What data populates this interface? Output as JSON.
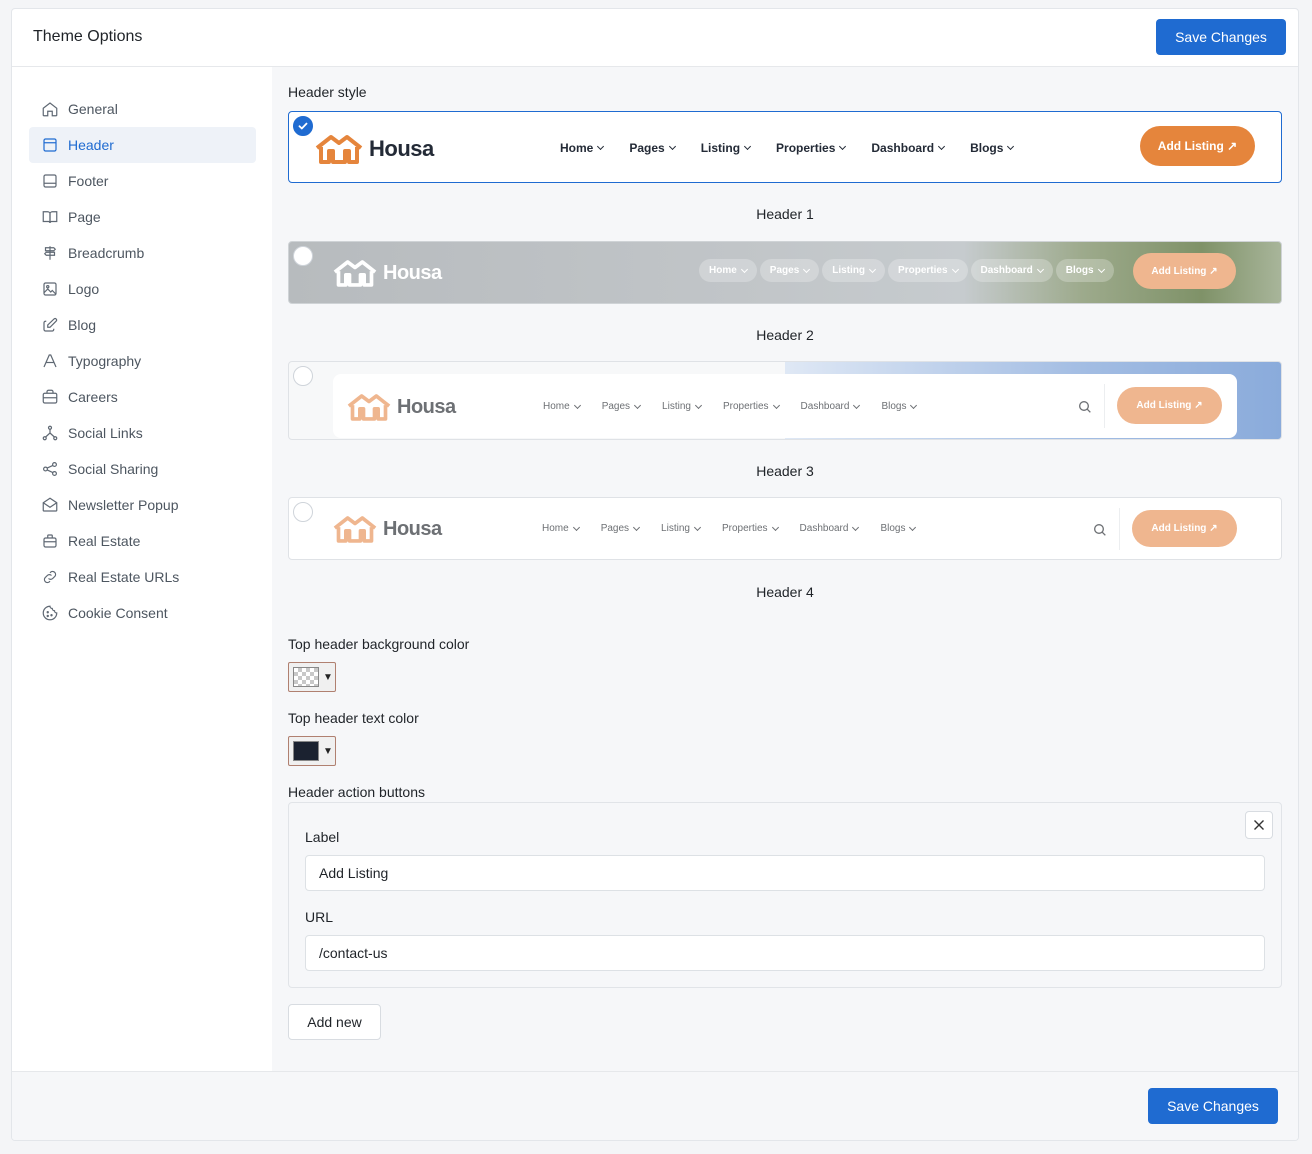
{
  "page": {
    "title": "Theme Options",
    "save_label": "Save Changes"
  },
  "sidebar": {
    "items": [
      {
        "label": "General",
        "icon": "home-icon"
      },
      {
        "label": "Header",
        "icon": "layout-header-icon",
        "active": true
      },
      {
        "label": "Footer",
        "icon": "layout-footer-icon"
      },
      {
        "label": "Page",
        "icon": "book-icon"
      },
      {
        "label": "Breadcrumb",
        "icon": "signpost-icon"
      },
      {
        "label": "Logo",
        "icon": "image-icon"
      },
      {
        "label": "Blog",
        "icon": "edit-icon"
      },
      {
        "label": "Typography",
        "icon": "typography-icon"
      },
      {
        "label": "Careers",
        "icon": "briefcase-icon"
      },
      {
        "label": "Social Links",
        "icon": "share-network-icon"
      },
      {
        "label": "Social Sharing",
        "icon": "share-icon"
      },
      {
        "label": "Newsletter Popup",
        "icon": "mail-open-icon"
      },
      {
        "label": "Real Estate",
        "icon": "building-icon"
      },
      {
        "label": "Real Estate URLs",
        "icon": "link-icon"
      },
      {
        "label": "Cookie Consent",
        "icon": "cookie-icon"
      }
    ]
  },
  "header_style": {
    "label": "Header style",
    "brand": "Housa",
    "menu": [
      "Home",
      "Pages",
      "Listing",
      "Properties",
      "Dashboard",
      "Blogs"
    ],
    "cta_label": "Add Listing ↗",
    "options": [
      {
        "caption": "Header 1",
        "selected": true
      },
      {
        "caption": "Header 2",
        "selected": false
      },
      {
        "caption": "Header 3",
        "selected": false
      },
      {
        "caption": "Header 4",
        "selected": false
      }
    ]
  },
  "colors": {
    "top_bg_label": "Top header background color",
    "top_bg_value": "transparent",
    "top_text_label": "Top header text color",
    "top_text_value": "#1b2230"
  },
  "action_buttons": {
    "label": "Header action buttons",
    "items": [
      {
        "label_title": "Label",
        "label_value": "Add Listing",
        "url_title": "URL",
        "url_value": "/contact-us"
      }
    ],
    "add_label": "Add new"
  },
  "theme": {
    "accent": "#1f6bd1",
    "brand_orange": "#e5853c",
    "brand_orange_light": "#efb68f"
  }
}
